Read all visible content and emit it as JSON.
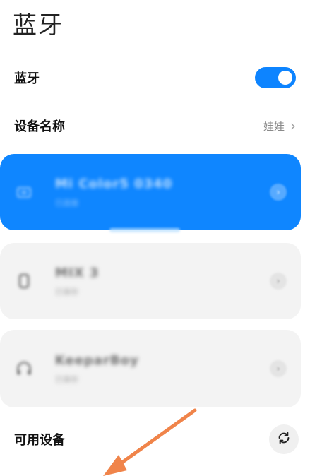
{
  "page": {
    "title": "蓝牙"
  },
  "bluetooth_row": {
    "label": "蓝牙",
    "toggle_on": true
  },
  "device_name_row": {
    "label": "设备名称",
    "value": "娃娃",
    "chevron": "›"
  },
  "devices": [
    {
      "icon": "laptop-icon",
      "name": "Mi Color5 0340",
      "status": "已连接",
      "chevron": "›"
    },
    {
      "icon": "phone-icon",
      "name": "MIX 3",
      "status": "已保存",
      "chevron": "›"
    },
    {
      "icon": "headphones-icon",
      "name": "KeeparBoy",
      "status": "已保存",
      "chevron": "›"
    }
  ],
  "available_row": {
    "label": "可用设备",
    "icon": "refresh-icon"
  },
  "annotation": {
    "icon": "arrow-icon",
    "color": "#f0844a"
  },
  "colors": {
    "accent": "#0f86ff",
    "card_gray": "#f3f3f3"
  }
}
